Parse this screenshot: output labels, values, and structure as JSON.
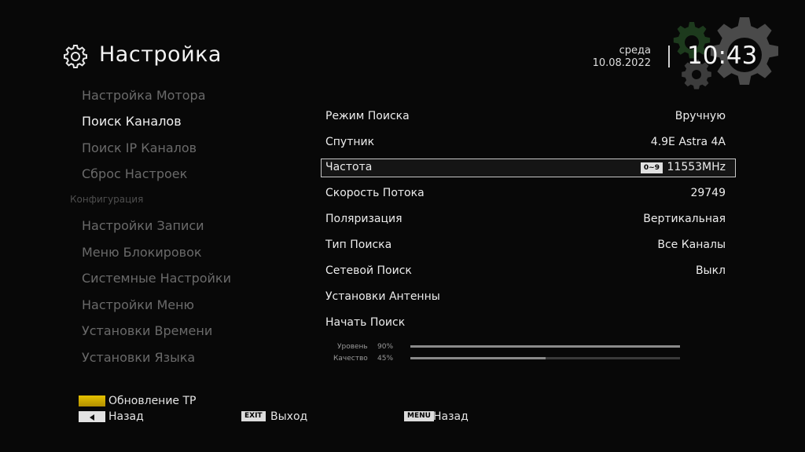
{
  "header": {
    "title": "Настройка",
    "weekday": "среда",
    "date": "10.08.2022",
    "time": "10:43"
  },
  "menu": {
    "items_top": [
      {
        "label": "Настройка Мотора",
        "active": false
      },
      {
        "label": "Поиск Каналов",
        "active": true
      },
      {
        "label": "Поиск IP Каналов",
        "active": false
      },
      {
        "label": "Сброс Настроек",
        "active": false
      }
    ],
    "category": "Конфигурация",
    "items_bottom": [
      {
        "label": "Настройки Записи"
      },
      {
        "label": "Меню Блокировок"
      },
      {
        "label": "Системные Настройки"
      },
      {
        "label": "Настройки Меню"
      },
      {
        "label": "Установки Времени"
      },
      {
        "label": "Установки Языка"
      }
    ]
  },
  "settings": [
    {
      "label": "Режим Поиска",
      "value": "Вручную"
    },
    {
      "label": "Спутник",
      "value": "4.9E Astra 4A"
    },
    {
      "label": "Частота",
      "value": "11553MHz",
      "tag": "0~9",
      "selected": true
    },
    {
      "label": "Скорость Потока",
      "value": "29749"
    },
    {
      "label": "Поляризация",
      "value": "Вертикальная"
    },
    {
      "label": "Тип Поиска",
      "value": "Все Каналы"
    },
    {
      "label": "Сетевой Поиск",
      "value": "Выкл"
    },
    {
      "label": "Установки Антенны",
      "value": ""
    },
    {
      "label": "Начать Поиск",
      "value": ""
    }
  ],
  "signal": {
    "level_label": "Уровень",
    "level_text": "90%",
    "level_value": 1.0,
    "quality_label": "Качество",
    "quality_text": "45%",
    "quality_value": 0.5
  },
  "legend": {
    "yellow_text": "Обновление TP",
    "back_text": "Назад",
    "exit_tag": "EXIT",
    "exit_text": "Выход",
    "menu_tag": "MENU",
    "menu_text": "Назад"
  },
  "colors": {
    "background": "#080808",
    "yellow_key": "#d4b000",
    "accent_green": "#1f5a1f"
  }
}
